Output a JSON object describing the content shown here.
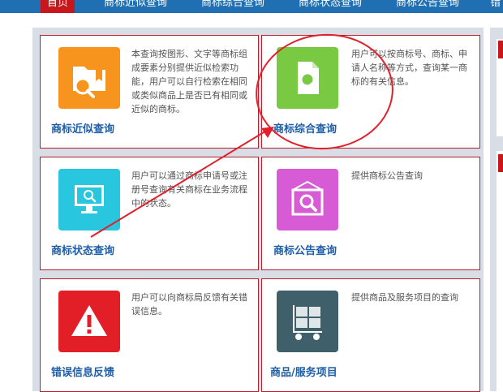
{
  "nav": {
    "tabs": [
      {
        "label": "首页",
        "active": true
      },
      {
        "label": "商标近似查询"
      },
      {
        "label": "商标综合查询"
      },
      {
        "label": "商标状态查询"
      },
      {
        "label": "商标公告查询"
      },
      {
        "label": "错"
      }
    ]
  },
  "cards": [
    {
      "title": "商标近似查询",
      "desc": "本查询按图形、文字等商标组成要素分别提供近似检索功能，用户可以自行检索在相同或类似商品上是否已有相同或近似的商标。",
      "icon": "folder-search-icon",
      "color": "#f7941d"
    },
    {
      "title": "商标综合查询",
      "desc": "用户可以按商标号、商标、申请人名称等方式，查询某一商标的有关信息。",
      "icon": "document-search-icon",
      "color": "#7ac943"
    },
    {
      "title": "商标状态查询",
      "desc": "用户可以通过商标申请号或注册号查询有关商标在业务流程中的状态。",
      "icon": "monitor-search-icon",
      "color": "#29c6df"
    },
    {
      "title": "商标公告查询",
      "desc": "提供商标公告查询",
      "icon": "notice-search-icon",
      "color": "#d65bd4"
    },
    {
      "title": "错误信息反馈",
      "desc": "用户可以向商标局反馈有关错误信息。",
      "icon": "warning-icon",
      "color": "#e21e26"
    },
    {
      "title": "商品/服务项目",
      "desc": "提供商品及服务项目的查询",
      "icon": "cart-icon",
      "color": "#3f5f6b"
    }
  ],
  "annotation_color": "#e0202b"
}
